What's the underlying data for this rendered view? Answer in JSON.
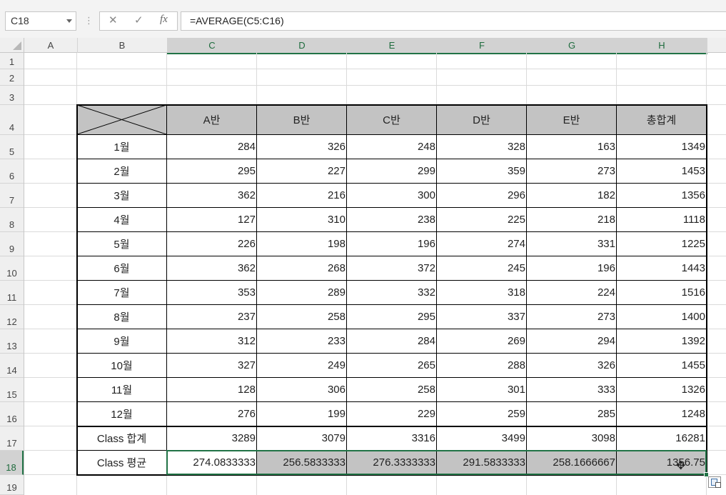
{
  "formula_bar": {
    "name_box": "C18",
    "formula": "=AVERAGE(C5:C16)",
    "cancel_glyph": "✕",
    "enter_glyph": "✓",
    "fx_glyph": "fx"
  },
  "columns": [
    "A",
    "B",
    "C",
    "D",
    "E",
    "F",
    "G",
    "H"
  ],
  "rows": [
    "1",
    "2",
    "3",
    "4",
    "5",
    "6",
    "7",
    "8",
    "9",
    "10",
    "11",
    "12",
    "13",
    "14",
    "15",
    "16",
    "17",
    "18",
    "19"
  ],
  "table": {
    "headers": [
      "A반",
      "B반",
      "C반",
      "D반",
      "E반",
      "총합계"
    ],
    "rows": [
      {
        "label": "1월",
        "values": [
          "284",
          "326",
          "248",
          "328",
          "163",
          "1349"
        ]
      },
      {
        "label": "2월",
        "values": [
          "295",
          "227",
          "299",
          "359",
          "273",
          "1453"
        ]
      },
      {
        "label": "3월",
        "values": [
          "362",
          "216",
          "300",
          "296",
          "182",
          "1356"
        ]
      },
      {
        "label": "4월",
        "values": [
          "127",
          "310",
          "238",
          "225",
          "218",
          "1118"
        ]
      },
      {
        "label": "5월",
        "values": [
          "226",
          "198",
          "196",
          "274",
          "331",
          "1225"
        ]
      },
      {
        "label": "6월",
        "values": [
          "362",
          "268",
          "372",
          "245",
          "196",
          "1443"
        ]
      },
      {
        "label": "7월",
        "values": [
          "353",
          "289",
          "332",
          "318",
          "224",
          "1516"
        ]
      },
      {
        "label": "8월",
        "values": [
          "237",
          "258",
          "295",
          "337",
          "273",
          "1400"
        ]
      },
      {
        "label": "9월",
        "values": [
          "312",
          "233",
          "284",
          "269",
          "294",
          "1392"
        ]
      },
      {
        "label": "10월",
        "values": [
          "327",
          "249",
          "265",
          "288",
          "326",
          "1455"
        ]
      },
      {
        "label": "11월",
        "values": [
          "128",
          "306",
          "258",
          "301",
          "333",
          "1326"
        ]
      },
      {
        "label": "12월",
        "values": [
          "276",
          "199",
          "229",
          "259",
          "285",
          "1248"
        ]
      },
      {
        "label": "Class 합계",
        "values": [
          "3289",
          "3079",
          "3316",
          "3499",
          "3098",
          "16281"
        ]
      },
      {
        "label": "Class 평균",
        "values": [
          "274.0833333",
          "256.5833333",
          "276.3333333",
          "291.5833333",
          "258.1666667",
          "1356.75"
        ]
      }
    ]
  },
  "selection": {
    "active_cell": "C18",
    "range": "C18:H18"
  }
}
